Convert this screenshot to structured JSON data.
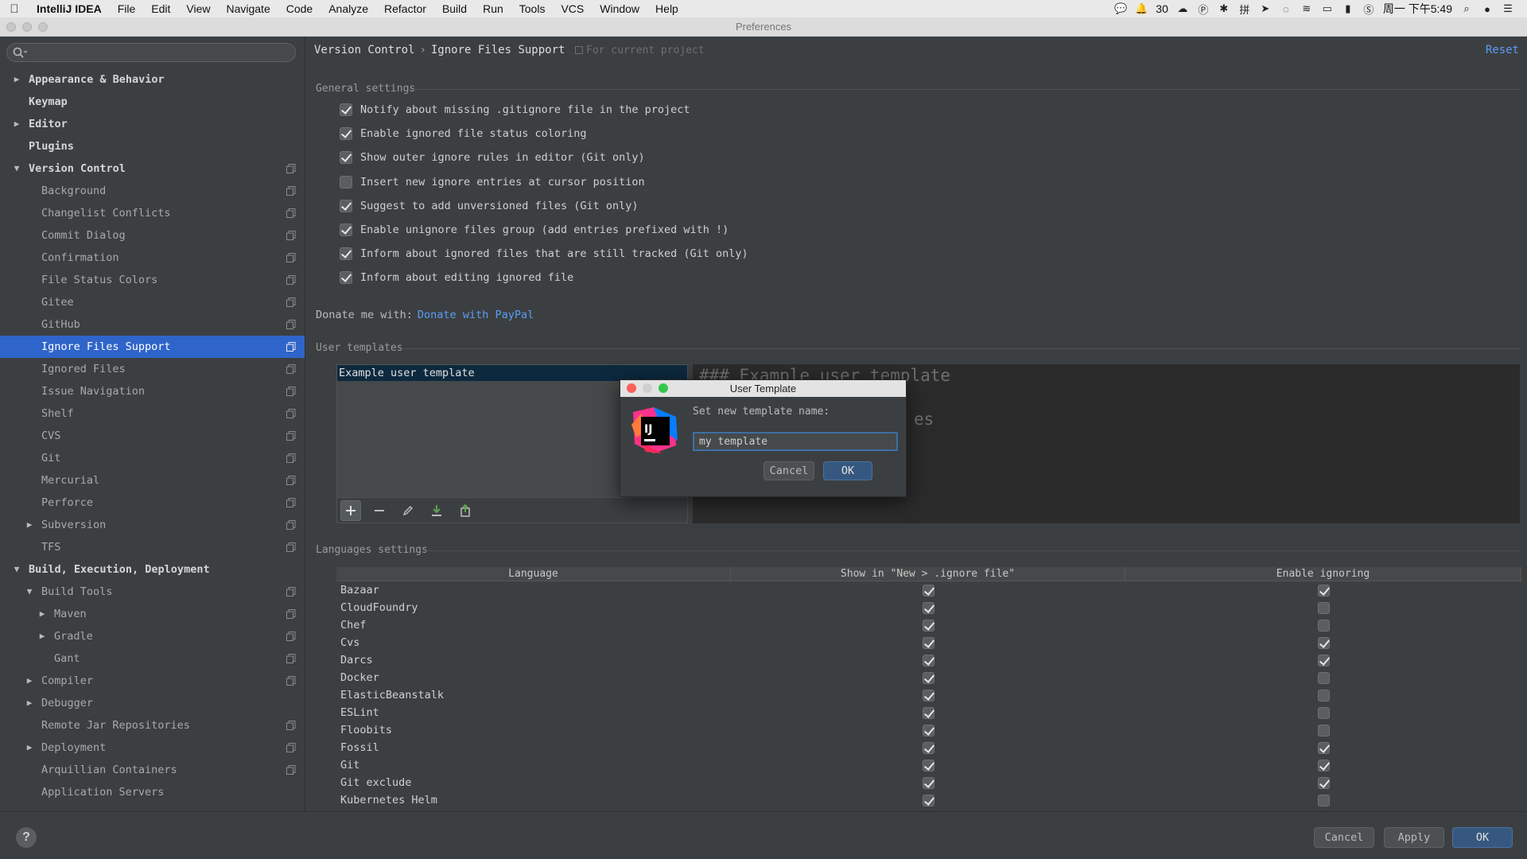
{
  "menubar": {
    "app": "IntelliJ IDEA",
    "items": [
      "File",
      "Edit",
      "View",
      "Navigate",
      "Code",
      "Analyze",
      "Refactor",
      "Build",
      "Run",
      "Tools",
      "VCS",
      "Window",
      "Help"
    ],
    "notification_count": "30",
    "clock": "周一 下午5:49"
  },
  "window": {
    "title": "Preferences"
  },
  "sidebar": {
    "search_placeholder": "",
    "items": [
      {
        "label": "Appearance & Behavior",
        "level": 0,
        "arrow": "right",
        "copy": false
      },
      {
        "label": "Keymap",
        "level": 0,
        "arrow": "",
        "copy": false
      },
      {
        "label": "Editor",
        "level": 0,
        "arrow": "right",
        "copy": false
      },
      {
        "label": "Plugins",
        "level": 0,
        "arrow": "",
        "copy": false
      },
      {
        "label": "Version Control",
        "level": 0,
        "arrow": "down",
        "copy": true
      },
      {
        "label": "Background",
        "level": 1,
        "arrow": "",
        "copy": true
      },
      {
        "label": "Changelist Conflicts",
        "level": 1,
        "arrow": "",
        "copy": true
      },
      {
        "label": "Commit Dialog",
        "level": 1,
        "arrow": "",
        "copy": true
      },
      {
        "label": "Confirmation",
        "level": 1,
        "arrow": "",
        "copy": true
      },
      {
        "label": "File Status Colors",
        "level": 1,
        "arrow": "",
        "copy": true
      },
      {
        "label": "Gitee",
        "level": 1,
        "arrow": "",
        "copy": true
      },
      {
        "label": "GitHub",
        "level": 1,
        "arrow": "",
        "copy": true
      },
      {
        "label": "Ignore Files Support",
        "level": 1,
        "arrow": "",
        "copy": true,
        "selected": true
      },
      {
        "label": "Ignored Files",
        "level": 1,
        "arrow": "",
        "copy": true
      },
      {
        "label": "Issue Navigation",
        "level": 1,
        "arrow": "",
        "copy": true
      },
      {
        "label": "Shelf",
        "level": 1,
        "arrow": "",
        "copy": true
      },
      {
        "label": "CVS",
        "level": 1,
        "arrow": "",
        "copy": true
      },
      {
        "label": "Git",
        "level": 1,
        "arrow": "",
        "copy": true
      },
      {
        "label": "Mercurial",
        "level": 1,
        "arrow": "",
        "copy": true
      },
      {
        "label": "Perforce",
        "level": 1,
        "arrow": "",
        "copy": true
      },
      {
        "label": "Subversion",
        "level": 1,
        "arrow": "right",
        "copy": true
      },
      {
        "label": "TFS",
        "level": 1,
        "arrow": "",
        "copy": true
      },
      {
        "label": "Build, Execution, Deployment",
        "level": 0,
        "arrow": "down",
        "copy": false
      },
      {
        "label": "Build Tools",
        "level": 1,
        "arrow": "down",
        "copy": true
      },
      {
        "label": "Maven",
        "level": 2,
        "arrow": "right",
        "copy": true
      },
      {
        "label": "Gradle",
        "level": 2,
        "arrow": "right",
        "copy": true
      },
      {
        "label": "Gant",
        "level": 2,
        "arrow": "",
        "copy": true
      },
      {
        "label": "Compiler",
        "level": 1,
        "arrow": "right",
        "copy": true
      },
      {
        "label": "Debugger",
        "level": 1,
        "arrow": "right",
        "copy": false
      },
      {
        "label": "Remote Jar Repositories",
        "level": 1,
        "arrow": "",
        "copy": true
      },
      {
        "label": "Deployment",
        "level": 1,
        "arrow": "right",
        "copy": true
      },
      {
        "label": "Arquillian Containers",
        "level": 1,
        "arrow": "",
        "copy": true
      },
      {
        "label": "Application Servers",
        "level": 1,
        "arrow": "",
        "copy": false
      }
    ]
  },
  "main": {
    "breadcrumb": [
      "Version Control",
      "Ignore Files Support"
    ],
    "breadcrumb_sep": "›",
    "scope": "For current project",
    "reset": "Reset",
    "general_title": "General settings",
    "general": [
      {
        "label": "Notify about missing .gitignore file in the project",
        "checked": true
      },
      {
        "label": "Enable ignored file status coloring",
        "checked": true
      },
      {
        "label": "Show outer ignore rules in editor (Git only)",
        "checked": true
      },
      {
        "label": "Insert new ignore entries at cursor position",
        "checked": false
      },
      {
        "label": "Suggest to add unversioned files (Git only)",
        "checked": true
      },
      {
        "label": "Enable unignore files group (add entries prefixed with !)",
        "checked": true
      },
      {
        "label": "Inform about ignored files that are still tracked (Git only)",
        "checked": true
      },
      {
        "label": "Inform about editing ignored file",
        "checked": true
      }
    ],
    "donate_label": "Donate me with:",
    "donate_link": "Donate with PayPal",
    "templates_title": "User templates",
    "template_item": "Example user template",
    "editor_lines": [
      "### Example user template",
      "es",
      "gen"
    ],
    "languages_title": "Languages settings",
    "table_headers": [
      "Language",
      "Show in \"New > .ignore file\"",
      "Enable ignoring"
    ],
    "languages": [
      {
        "name": "Bazaar",
        "show": true,
        "enable": true
      },
      {
        "name": "CloudFoundry",
        "show": true,
        "enable": false
      },
      {
        "name": "Chef",
        "show": true,
        "enable": false
      },
      {
        "name": "Cvs",
        "show": true,
        "enable": true
      },
      {
        "name": "Darcs",
        "show": true,
        "enable": true
      },
      {
        "name": "Docker",
        "show": true,
        "enable": false
      },
      {
        "name": "ElasticBeanstalk",
        "show": true,
        "enable": false
      },
      {
        "name": "ESLint",
        "show": true,
        "enable": false
      },
      {
        "name": "Floobits",
        "show": true,
        "enable": false
      },
      {
        "name": "Fossil",
        "show": true,
        "enable": true
      },
      {
        "name": "Git",
        "show": true,
        "enable": true
      },
      {
        "name": "Git exclude",
        "show": true,
        "enable": true
      },
      {
        "name": "Kubernetes Helm",
        "show": true,
        "enable": false
      }
    ]
  },
  "dialog": {
    "title": "User Template",
    "prompt": "Set new template name:",
    "input_value": "my template",
    "cancel": "Cancel",
    "ok": "OK",
    "logo_text": "IJ"
  },
  "footer": {
    "help": "?",
    "cancel": "Cancel",
    "apply": "Apply",
    "ok": "OK"
  },
  "colors": {
    "accent": "#2f65ca",
    "link": "#589df6",
    "primary_button": "#365880"
  }
}
